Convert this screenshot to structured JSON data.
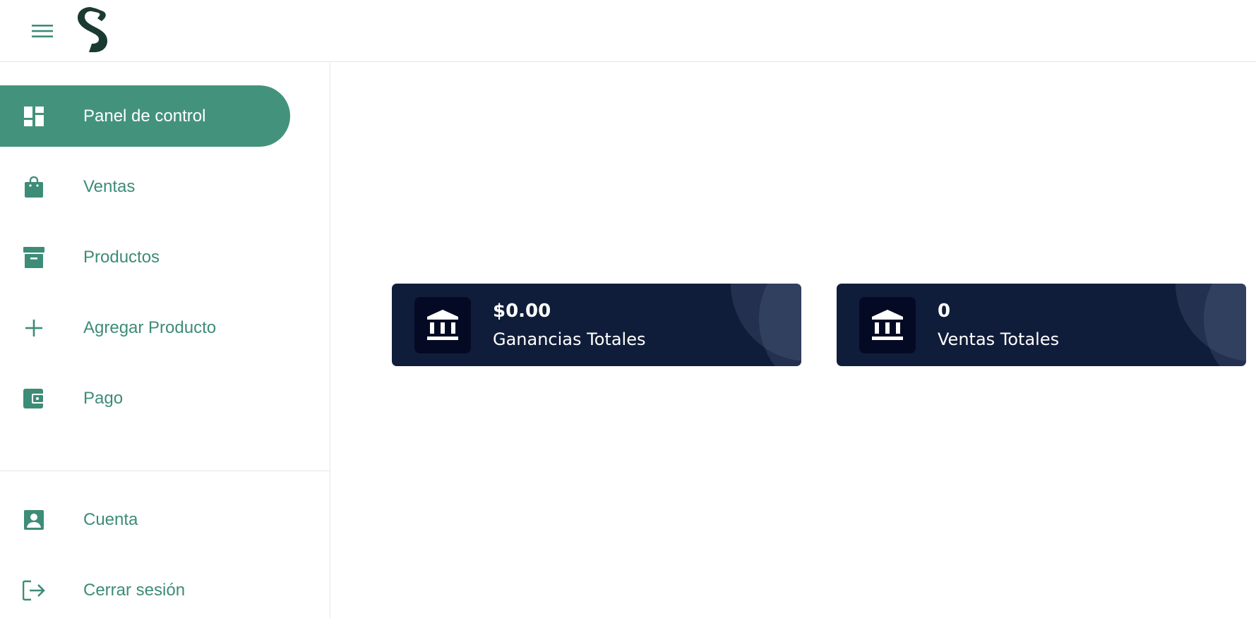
{
  "header": {
    "menu_icon": "hamburger-icon",
    "logo_icon": "s-logo-icon"
  },
  "sidebar": {
    "items": [
      {
        "label": "Panel de control",
        "icon": "dashboard-icon",
        "active": true
      },
      {
        "label": "Ventas",
        "icon": "shopping-bag-icon",
        "active": false
      },
      {
        "label": "Productos",
        "icon": "archive-box-icon",
        "active": false
      },
      {
        "label": "Agregar Producto",
        "icon": "plus-icon",
        "active": false
      },
      {
        "label": "Pago",
        "icon": "wallet-icon",
        "active": false
      }
    ],
    "bottom_items": [
      {
        "label": "Cuenta",
        "icon": "account-box-icon"
      },
      {
        "label": "Cerrar sesión",
        "icon": "logout-icon"
      }
    ]
  },
  "cards": [
    {
      "value": "$0.00",
      "title": "Ganancias Totales",
      "icon": "bank-icon"
    },
    {
      "value": "0",
      "title": "Ventas Totales",
      "icon": "bank-icon"
    }
  ],
  "colors": {
    "accent": "#43937c",
    "text_accent": "#3d8c77",
    "card_bg": "#101d3a",
    "card_icon_bg": "#050a24",
    "logo": "#1b3a32"
  }
}
